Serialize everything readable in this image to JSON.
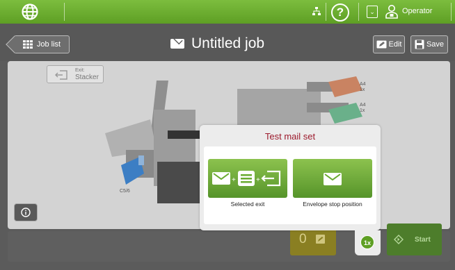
{
  "topbar": {
    "user_name": "Operator",
    "icons": [
      "globe-icon",
      "network-icon",
      "help-icon",
      "dropdown-icon",
      "user-icon"
    ],
    "accent": "#6aab30"
  },
  "header": {
    "job_list_label": "Job list",
    "title": "Untitled job",
    "edit_label": "Edit",
    "save_label": "Save"
  },
  "machine": {
    "exit_line1": "Exit:",
    "exit_line2": "Stacker",
    "envelope_label": "C5/6",
    "feeder1_size": "A4",
    "feeder1_count": "1x",
    "feeder2_size": "A4",
    "feeder2_count": "1x"
  },
  "dialog": {
    "title": "Test mail set",
    "option1_label": "Selected exit",
    "option2_label": "Envelope stop position",
    "badge": "1x"
  },
  "bottom": {
    "counter": "0",
    "start_label": "Start"
  },
  "colors": {
    "title_red": "#9c1a2c",
    "green": "#6aab30",
    "counter_yellow": "#8a7f22"
  }
}
